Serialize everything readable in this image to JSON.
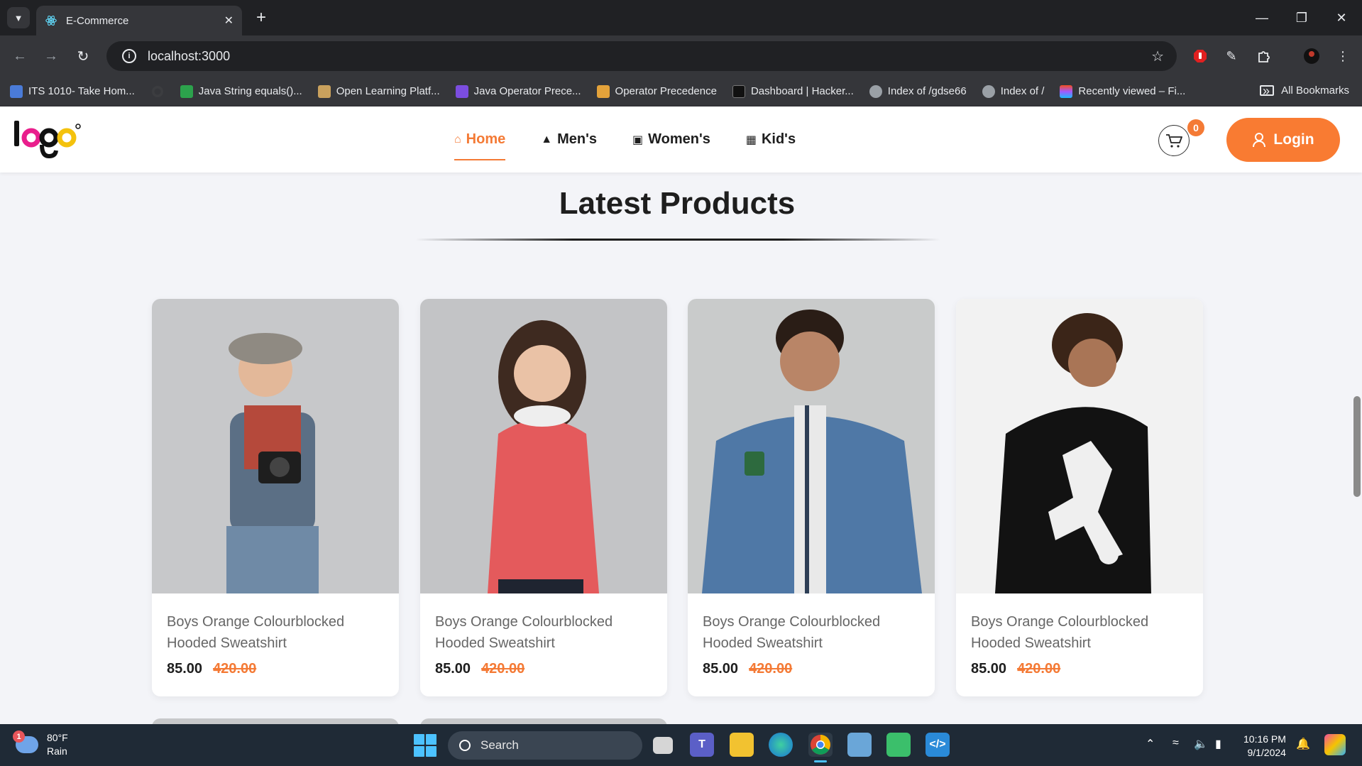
{
  "browser": {
    "tab_title": "E-Commerce",
    "url": "localhost:3000",
    "bookmarks": [
      {
        "label": "ITS 1010- Take Hom...",
        "color": "#4a7bd8"
      },
      {
        "label": "",
        "color": "#555"
      },
      {
        "label": "Java String equals()...",
        "color": "#2ca24c"
      },
      {
        "label": "Open Learning Platf...",
        "color": "#c9a15d"
      },
      {
        "label": "Java Operator Prece...",
        "color": "#7b4ddf"
      },
      {
        "label": "Operator Precedence",
        "color": "#e3a23a"
      },
      {
        "label": "Dashboard | Hacker...",
        "color": "#111"
      },
      {
        "label": "Index of /gdse66",
        "color": "#9aa0a6"
      },
      {
        "label": "Index of /",
        "color": "#9aa0a6"
      },
      {
        "label": "Recently viewed – Fi...",
        "color": "#f24e1e"
      }
    ],
    "all_bookmarks": "All Bookmarks"
  },
  "site": {
    "nav": [
      {
        "label": "Home",
        "icon": "home-icon",
        "active": true
      },
      {
        "label": "Men's",
        "icon": "shapes-icon",
        "active": false
      },
      {
        "label": "Women's",
        "icon": "bag-icon",
        "active": false
      },
      {
        "label": "Kid's",
        "icon": "badge-icon",
        "active": false
      }
    ],
    "cart_count": "0",
    "login_label": "Login",
    "section_title": "Latest Products",
    "products": [
      {
        "name": "Boys Orange Colourblocked Hooded Sweatshirt",
        "price": "85.00",
        "old_price": "420.00",
        "bg": "#c7c8ca"
      },
      {
        "name": "Boys Orange Colourblocked Hooded Sweatshirt",
        "price": "85.00",
        "old_price": "420.00",
        "bg": "#c3c4c6"
      },
      {
        "name": "Boys Orange Colourblocked Hooded Sweatshirt",
        "price": "85.00",
        "old_price": "420.00",
        "bg": "#c9cbcb"
      },
      {
        "name": "Boys Orange Colourblocked Hooded Sweatshirt",
        "price": "85.00",
        "old_price": "420.00",
        "bg": "#f2f2f2"
      }
    ],
    "accent": "#f47a35"
  },
  "taskbar": {
    "weather_temp": "80°F",
    "weather_desc": "Rain",
    "weather_badge": "1",
    "search_label": "Search",
    "time": "10:16 PM",
    "date": "9/1/2024"
  }
}
